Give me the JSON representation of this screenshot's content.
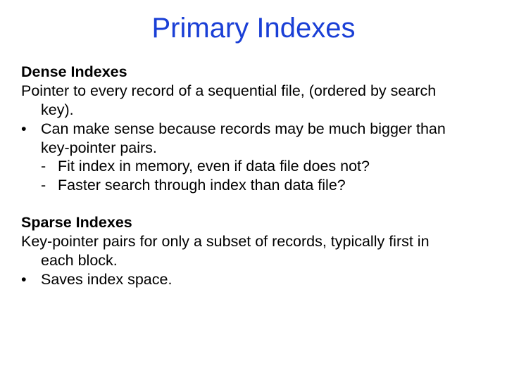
{
  "title": "Primary Indexes",
  "dense": {
    "heading": "Dense Indexes",
    "intro_line1": "Pointer to every record of a sequential file, (ordered by search",
    "intro_line2": "key).",
    "bullet_line1": "Can make sense because records may be much bigger than",
    "bullet_line2": "key-pointer pairs.",
    "dash1": "Fit index in memory, even if data file does not?",
    "dash2": "Faster search through index than data file?"
  },
  "sparse": {
    "heading": "Sparse Indexes",
    "intro_line1": "Key-pointer pairs for only a subset of records, typically first in",
    "intro_line2": "each block.",
    "bullet": "Saves index space."
  },
  "marks": {
    "bullet": "•",
    "dash": "-"
  }
}
